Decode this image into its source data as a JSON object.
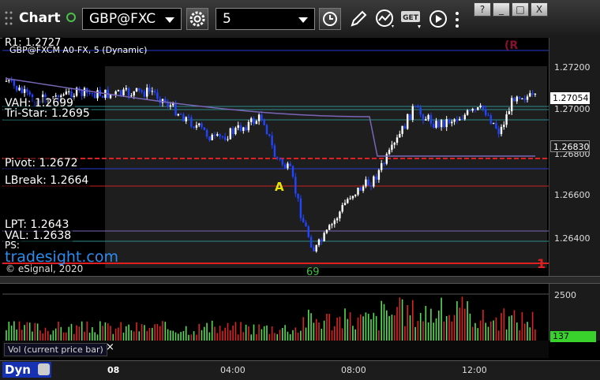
{
  "toolbar": {
    "title": "Chart",
    "symbol": "GBP@FXC",
    "interval": "5",
    "window_buttons": [
      "?",
      "_",
      "□",
      "X"
    ]
  },
  "chart": {
    "header": "GBP@FXCM A0-FX, 5 (Dynamic)",
    "watermark": "tradesight.com",
    "copyright": "© eSignal, 2020",
    "price_labels": [
      "1.27200",
      "1.27000",
      "1.26800",
      "1.26600",
      "1.26400"
    ],
    "last_price": "1.27054",
    "ma_price": "1.26830",
    "levels": {
      "r1": "R1: 1.2727",
      "vah": "VAH: 1.2699",
      "tristar": "Tri-Star: 1.2695",
      "pivot": "Pivot: 1.2672",
      "lbreak": "LBreak: 1.2664",
      "lpt": "LPT: 1.2643",
      "val": "VAL: 1.2638",
      "ps": "PS:"
    },
    "marker_a": "A",
    "marker_1": "1",
    "marker_r": "(R",
    "marker_bottom": "69"
  },
  "volume": {
    "axis_label": "2500",
    "current": "137",
    "caption": "Vol (current price bar)",
    "close_label": "×"
  },
  "timeaxis": {
    "panel_label": "Dyn",
    "ticks": [
      "08",
      "04:00",
      "08:00",
      "12:00"
    ]
  },
  "colors": {
    "up": "#ffffff",
    "down": "#2244ff",
    "vol_up": "#55dd55",
    "vol_down": "#dd2222",
    "ma": "#7a66b8",
    "price_tag": "#ffffff",
    "vol_tag": "#39d12c"
  }
}
